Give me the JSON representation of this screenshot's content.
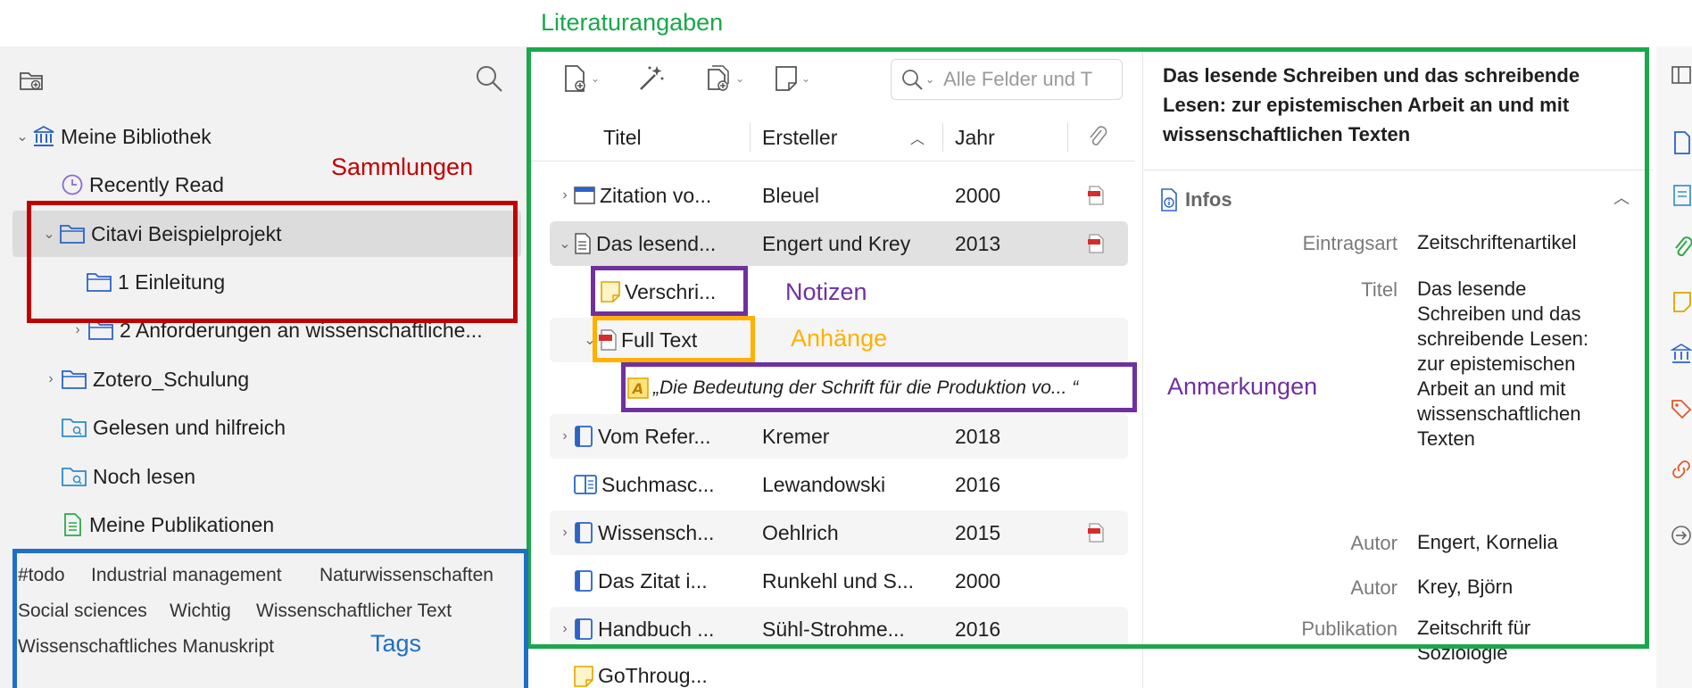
{
  "annotations": {
    "literaturangaben": "Literaturangaben",
    "sammlungen": "Sammlungen",
    "notizen": "Notizen",
    "anhaenge": "Anhänge",
    "anmerkungen": "Anmerkungen",
    "tags": "Tags",
    "colors": {
      "green": "#1aa84a",
      "red": "#c00000",
      "purple": "#7030a0",
      "orange": "#ffb000",
      "blue": "#1f6fc5"
    }
  },
  "library": {
    "root": "Meine Bibliothek",
    "items": [
      {
        "label": "Recently Read"
      },
      {
        "label": "Citavi Beispielprojekt"
      },
      {
        "label": "1 Einleitung"
      },
      {
        "label": "2 Anforderungen an wissenschaftliche..."
      },
      {
        "label": "Zotero_Schulung"
      },
      {
        "label": "Gelesen und hilfreich"
      },
      {
        "label": "Noch lesen"
      },
      {
        "label": "Meine Publikationen"
      }
    ]
  },
  "tags": [
    "#todo",
    "Industrial management",
    "Naturwissenschaften",
    "Social sciences",
    "Wichtig",
    "Wissenschaftlicher Text",
    "Wissenschaftliches Manuskript"
  ],
  "toolbar": {
    "search_placeholder": "Alle Felder und T"
  },
  "columns": {
    "title": "Titel",
    "creator": "Ersteller",
    "year": "Jahr"
  },
  "items": [
    {
      "title": "Zitation vo...",
      "creator": "Bleuel",
      "year": "2000",
      "pdf": true
    },
    {
      "title": "Das lesend...",
      "creator": "Engert und Krey",
      "year": "2013",
      "pdf": true
    },
    {
      "title": "Verschri..."
    },
    {
      "title": "Full Text"
    },
    {
      "title": "„Die Bedeutung der Schrift für die Produktion vo... “"
    },
    {
      "title": "Vom Refer...",
      "creator": "Kremer",
      "year": "2018"
    },
    {
      "title": "Suchmasc...",
      "creator": "Lewandowski",
      "year": "2016"
    },
    {
      "title": "Wissensch...",
      "creator": "Oehlrich",
      "year": "2015",
      "pdf": true
    },
    {
      "title": "Das Zitat i...",
      "creator": "Runkehl und S...",
      "year": "2000"
    },
    {
      "title": "Handbuch ...",
      "creator": "Sühl-Strohme...",
      "year": "2016"
    },
    {
      "title": "GoThroug..."
    }
  ],
  "detail": {
    "title": "Das lesende Schreiben und das schreibende Lesen: zur epistemischen Arbeit an und mit wissenschaftlichen Texten",
    "section": "Infos",
    "fields": [
      {
        "label": "Eintragsart",
        "value": "Zeitschriftenartikel"
      },
      {
        "label": "Titel",
        "value": "Das lesende Schreiben und das schreibende Lesen: zur epistemischen Arbeit an und mit wissenschaftlichen Texten"
      },
      {
        "label": "Autor",
        "value": "Engert, Kornelia"
      },
      {
        "label": "Autor",
        "value": "Krey, Björn"
      },
      {
        "label": "Publikation",
        "value": "Zeitschrift für Soziologie"
      }
    ]
  }
}
